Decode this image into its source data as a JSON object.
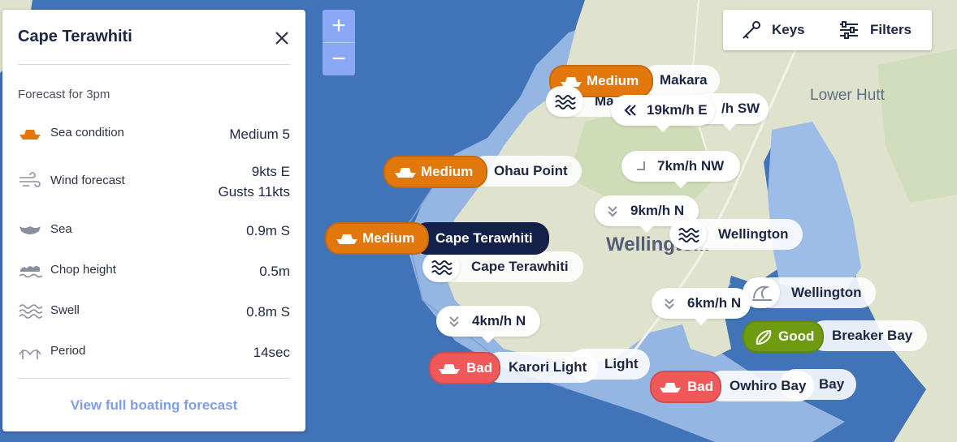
{
  "panel": {
    "title": "Cape Terawhiti",
    "forecast_for": "Forecast for 3pm",
    "rows": [
      {
        "icon": "boat-icon",
        "label": "Sea condition",
        "value": "Medium 5"
      },
      {
        "icon": "wind-icon",
        "label": "Wind forecast",
        "value": "9kts E",
        "value2": "Gusts 11kts"
      },
      {
        "icon": "sea-icon",
        "label": "Sea",
        "value": "0.9m S"
      },
      {
        "icon": "chop-icon",
        "label": "Chop height",
        "value": "0.5m"
      },
      {
        "icon": "swell-icon",
        "label": "Swell",
        "value": "0.8m S"
      },
      {
        "icon": "period-icon",
        "label": "Period",
        "value": "14sec"
      }
    ],
    "view_full": "View full boating forecast"
  },
  "toolbar": {
    "keys": "Keys",
    "filters": "Filters"
  },
  "zoom": {
    "in": "+",
    "out": "−"
  },
  "map": {
    "city_label": "Wellingto...",
    "suburb_label": "Lower Hutt",
    "name_pills": {
      "makara": "Makara",
      "makara_hidden": "Ma",
      "wind_hidden": "/h SW",
      "ohau": "Ohau Point",
      "cape_wave": "Cape Terawhiti",
      "wellington_wave": "Wellington",
      "wellington_surf": "Wellington",
      "breaker": "Breaker Bay",
      "karori": "Karori Light",
      "karori_hidden": "Light",
      "owhiro": "Owhiro Bay",
      "owhiro_hidden": "Bay",
      "cape_selected": "Cape Terawhiti"
    },
    "status": {
      "makara": "Medium",
      "ohau": "Medium",
      "cape": "Medium",
      "breaker": "Good",
      "karori": "Bad",
      "owhiro": "Bad"
    },
    "wind": {
      "w1": "19km/h E",
      "w2": "7km/h NW",
      "w3": "9km/h N",
      "w4": "6km/h N",
      "w5": "4km/h N"
    }
  },
  "colors": {
    "medium": "#e2780c",
    "good": "#6f9b10",
    "bad": "#f0585a",
    "selected": "#12204a",
    "sea": "#4173b8",
    "zone": "#9ebce8",
    "land": "#dfe3cd",
    "accent": "#7f9ee9"
  }
}
